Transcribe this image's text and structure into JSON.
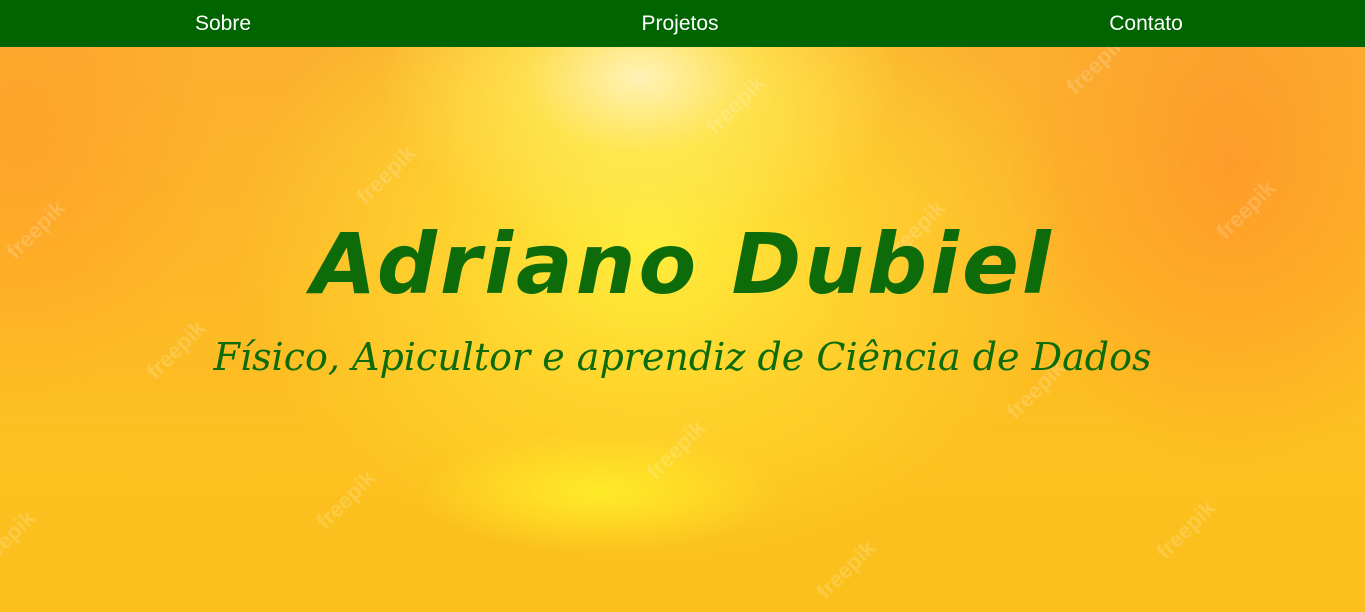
{
  "nav": {
    "items": [
      {
        "label": "Sobre"
      },
      {
        "label": "Projetos"
      },
      {
        "label": "Contato"
      }
    ]
  },
  "hero": {
    "title": "Adriano Dubiel",
    "subtitle": "Físico, Apicultor e aprendiz de Ciência de Dados",
    "watermark_text": "freepik"
  },
  "colors": {
    "navbar_background": "#006400",
    "nav_text": "#ffffff",
    "title_text": "#0d6b0a",
    "hero_gradient_center": "#fff55a",
    "hero_gradient_edge": "#fbaa2c"
  }
}
